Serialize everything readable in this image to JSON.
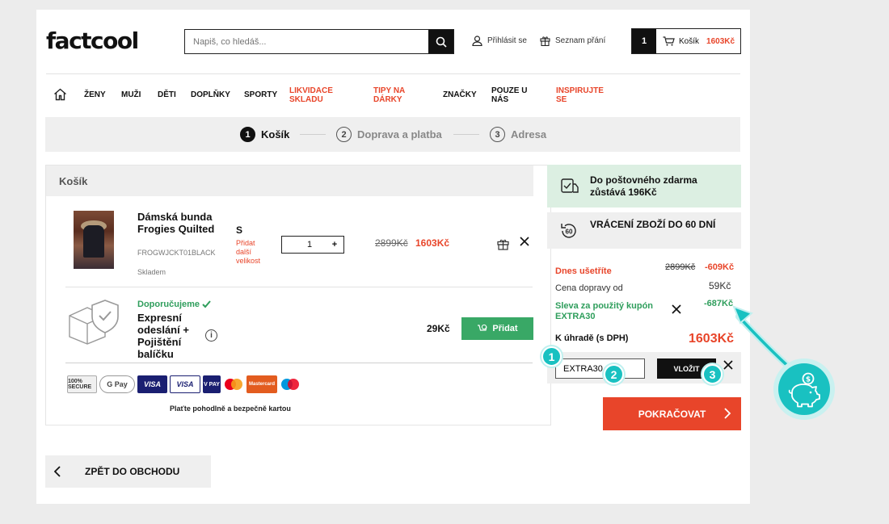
{
  "header": {
    "logo": "factcool",
    "search_placeholder": "Napiš, co hledáš...",
    "login": "Přihlásit se",
    "wishlist": "Seznam přání",
    "cart_count": "1",
    "cart_label": "Košík",
    "cart_total": "1603Kč"
  },
  "nav": {
    "items": [
      "ŽENY",
      "MUŽI",
      "DĚTI",
      "DOPLŇKY",
      "SPORTY",
      "LIKVIDACE SKLADU",
      "TIPY NA DÁRKY",
      "ZNAČKY",
      "POUZE U NÁS",
      "INSPIRUJTE SE"
    ]
  },
  "steps": [
    {
      "num": "1",
      "label": "Košík"
    },
    {
      "num": "2",
      "label": "Doprava a platba"
    },
    {
      "num": "3",
      "label": "Adresa"
    }
  ],
  "cart": {
    "heading": "Košík",
    "product": {
      "name": "Dámská bunda Frogies Quilted",
      "sku": "FROGWJCKT01BLACK",
      "stock": "Skladem",
      "size": "S",
      "add_size": "Přidat další velikost",
      "qty": "1",
      "qty_plus": "+",
      "old_price": "2899Kč",
      "price": "1603Kč"
    },
    "extra": {
      "recommended": "Doporučujeme",
      "name": "Expresní odeslání + Pojištění balíčku",
      "info": "i",
      "price": "29Kč",
      "add_button": "Přidat"
    },
    "payment_text": "Plaťte pohodlně a bezpečně kartou",
    "payment_cards": [
      "100% SECURE",
      "G Pay",
      "VISA",
      "VISA",
      "V PAY",
      "Mastercard",
      "Maestro"
    ]
  },
  "summary": {
    "free_shipping": "Do poštovného zdarma zůstává 196Kč",
    "returns": "VRÁCENÍ ZBOŽÍ DO 60 DNÍ",
    "returns_icon": "60",
    "saved_label": "Dnes ušetříte",
    "saved_old": "2899Kč",
    "saved_value": "-609Kč",
    "shipping_label": "Cena dopravy od",
    "shipping_value": "59Kč",
    "coupon_label": "Sleva za použitý kupón EXTRA30",
    "coupon_value": "-687Kč",
    "total_label": "K úhradě (s DPH)",
    "total_value": "1603Kč",
    "coupon_input": "EXTRA30",
    "apply_button": "VLOŽIT",
    "continue_button": "POKRAČOVAT"
  },
  "back_button": "ZPĚT DO OBCHODU",
  "tutorial": {
    "badges": [
      "1",
      "2",
      "3"
    ]
  },
  "colors": {
    "accent": "#e8452a",
    "green": "#39a866",
    "teal": "#19c1c1"
  }
}
